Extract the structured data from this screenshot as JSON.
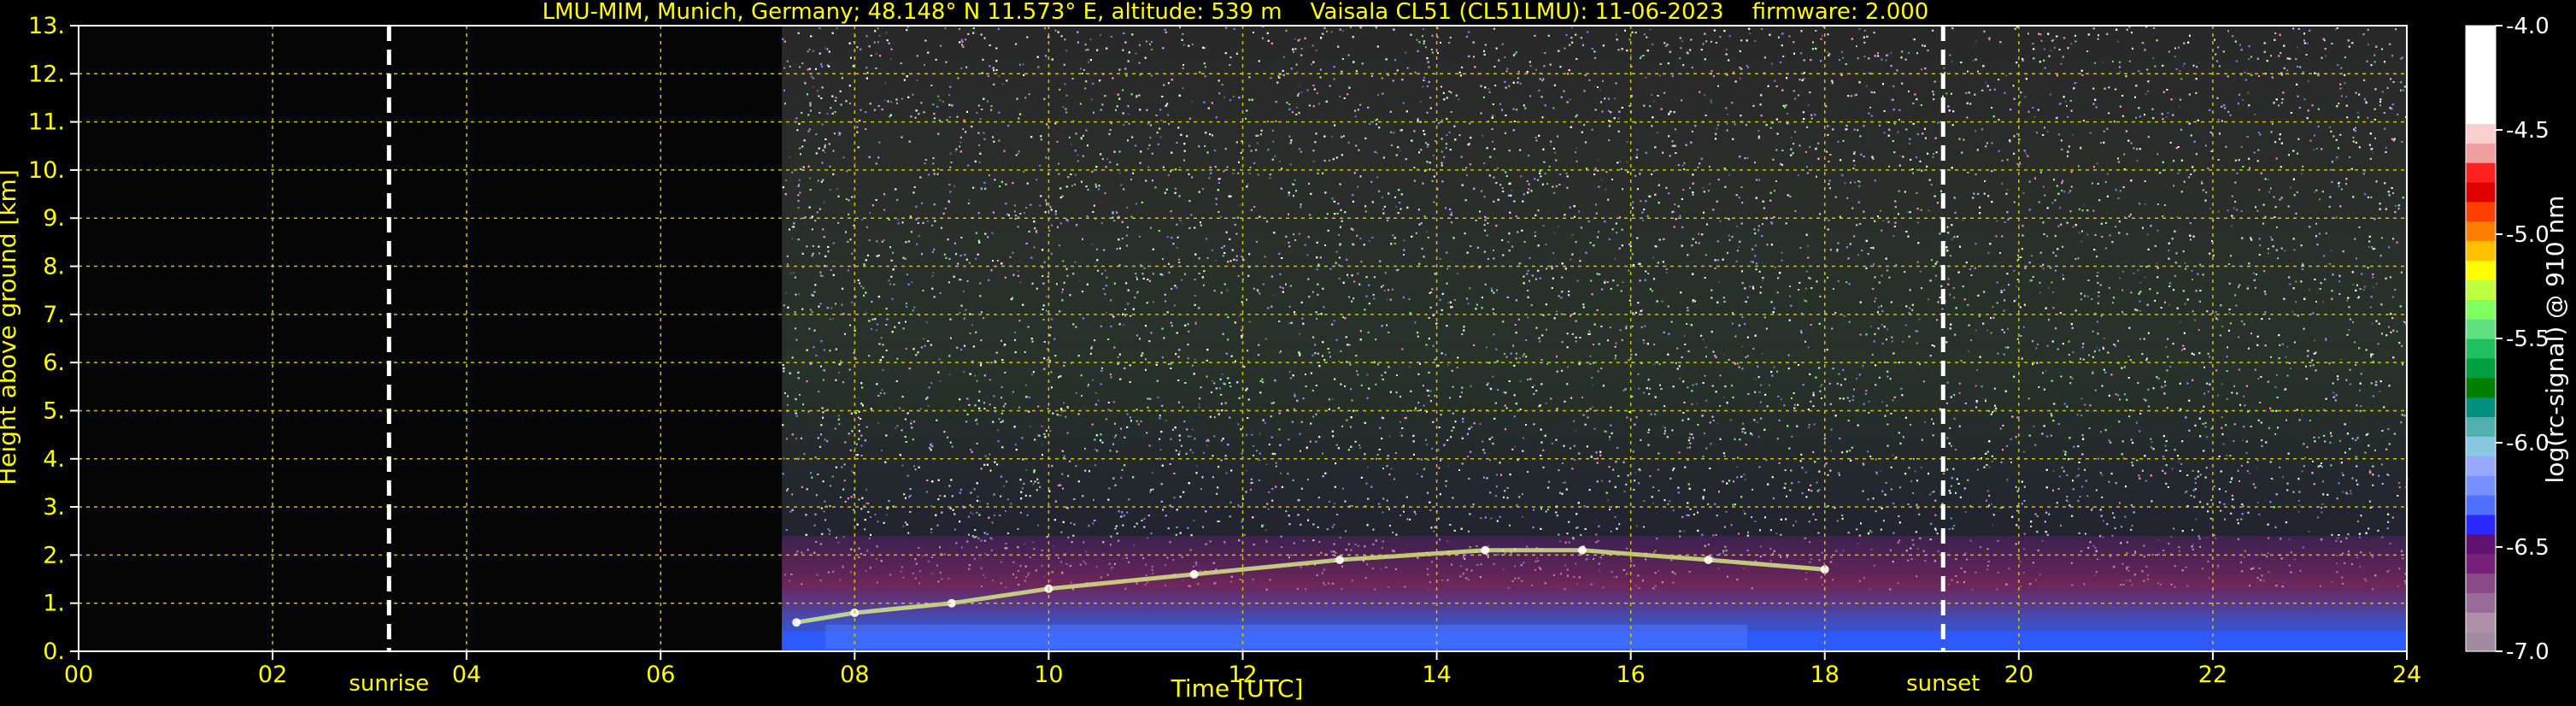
{
  "chart_data": {
    "type": "heatmap",
    "title": "LMU-MIM, Munich, Germany; 48.148° N 11.573° E, altitude: 539 m    Vaisala CL51 (CL51LMU): 11-06-2023    firmware: 2.000",
    "xlabel": "Time [UTC]",
    "ylabel": "Height above ground [km]",
    "xlim": [
      0,
      24
    ],
    "ylim": [
      0,
      13
    ],
    "x_ticks": [
      "00",
      "02",
      "04",
      "06",
      "08",
      "10",
      "12",
      "14",
      "16",
      "18",
      "20",
      "22",
      "24"
    ],
    "y_ticks": [
      "0.",
      "1.",
      "2.",
      "3.",
      "4.",
      "5.",
      "6.",
      "7.",
      "8.",
      "9.",
      "10.",
      "11.",
      "12.",
      "13."
    ],
    "grid": true,
    "data_start_hour": 7.25,
    "events": [
      {
        "label": "sunrise",
        "hour": 3.2
      },
      {
        "label": "sunset",
        "hour": 19.22
      }
    ],
    "boundary_layer_height_km": [
      {
        "hour": 7.4,
        "km": 0.6
      },
      {
        "hour": 8.0,
        "km": 0.8
      },
      {
        "hour": 9.0,
        "km": 1.0
      },
      {
        "hour": 10.0,
        "km": 1.3
      },
      {
        "hour": 11.5,
        "km": 1.6
      },
      {
        "hour": 13.0,
        "km": 1.9
      },
      {
        "hour": 14.5,
        "km": 2.1
      },
      {
        "hour": 15.5,
        "km": 2.1
      },
      {
        "hour": 16.8,
        "km": 1.9
      },
      {
        "hour": 18.0,
        "km": 1.7
      }
    ],
    "colorbar": {
      "label": "log(rc-signal) @ 910 nm",
      "range": [
        -7.0,
        -4.0
      ],
      "ticks": [
        "-4.0",
        "-4.5",
        "-5.0",
        "-5.5",
        "-6.0",
        "-6.5",
        "-7.0"
      ],
      "colors": [
        "#a08ca0",
        "#b090a8",
        "#9a6a98",
        "#8a4a88",
        "#76207a",
        "#601070",
        "#2828ff",
        "#5070ff",
        "#7890ff",
        "#98a8ff",
        "#88c8e0",
        "#50b0b0",
        "#009080",
        "#008000",
        "#00a040",
        "#20c060",
        "#60e080",
        "#80ff60",
        "#c0ff40",
        "#ffff00",
        "#ffc000",
        "#ff8000",
        "#ff4000",
        "#e00000",
        "#ff2020",
        "#f0a0a0",
        "#f8d0d0",
        "#ffffff",
        "#ffffff",
        "#ffffff",
        "#ffffff",
        "#ffffff"
      ]
    }
  },
  "colors": {
    "text": "#ffff00",
    "grid": "#d4c400",
    "background": "#000000"
  }
}
